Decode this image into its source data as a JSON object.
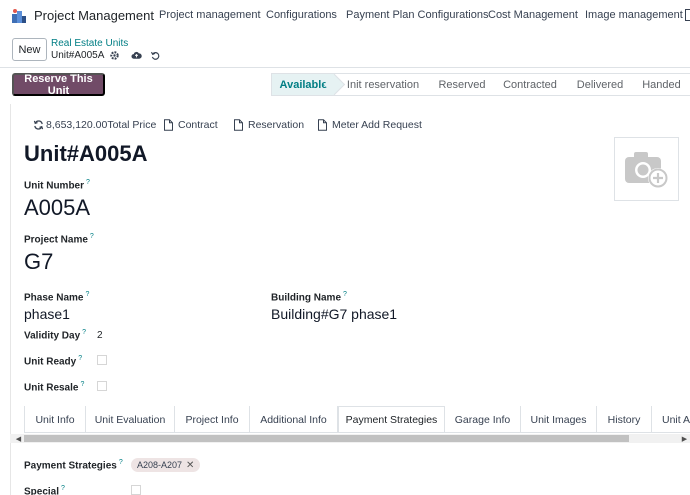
{
  "nav": {
    "app_name": "Project Management",
    "menu": [
      "Project management",
      "Configurations",
      "Payment Plan Configurations",
      "Cost Management",
      "Image management"
    ]
  },
  "breadcrumb": {
    "new_label": "New",
    "parent": "Real Estate Units",
    "current": "Unit#A005A"
  },
  "actions": {
    "reserve_label": "Reserve This Unit"
  },
  "statusbar": {
    "stages": [
      "Available",
      "Init reservation",
      "Reserved",
      "Contracted",
      "Delivered",
      "Handed"
    ],
    "active": "Available"
  },
  "smart_buttons": {
    "total_price_value": "8,653,120.00",
    "total_price_label": "Total Price",
    "contract": "Contract",
    "reservation": "Reservation",
    "meter": "Meter Add Request"
  },
  "form": {
    "title": "Unit#A005A",
    "unit_number_label": "Unit Number",
    "unit_number": "A005A",
    "project_name_label": "Project Name",
    "project_name": "G7",
    "phase_name_label": "Phase Name",
    "phase_name": "phase1",
    "building_name_label": "Building Name",
    "building_name": "Building#G7 phase1",
    "validity_day_label": "Validity Day",
    "validity_day": "2",
    "unit_ready_label": "Unit Ready",
    "unit_resale_label": "Unit Resale",
    "help_mark": "?"
  },
  "tabs": [
    "Unit Info",
    "Unit Evaluation",
    "Project Info",
    "Additional Info",
    "Payment Strategies",
    "Garage Info",
    "Unit Images",
    "History",
    "Unit A"
  ],
  "active_tab": "Payment Strategies",
  "payment": {
    "strategies_label": "Payment Strategies",
    "strategy_tag": "A208-A207",
    "special_label": "Special"
  },
  "colors": {
    "primary": "#714b67",
    "accent": "#017e84",
    "active_stage_bg": "#e6f2f3"
  }
}
